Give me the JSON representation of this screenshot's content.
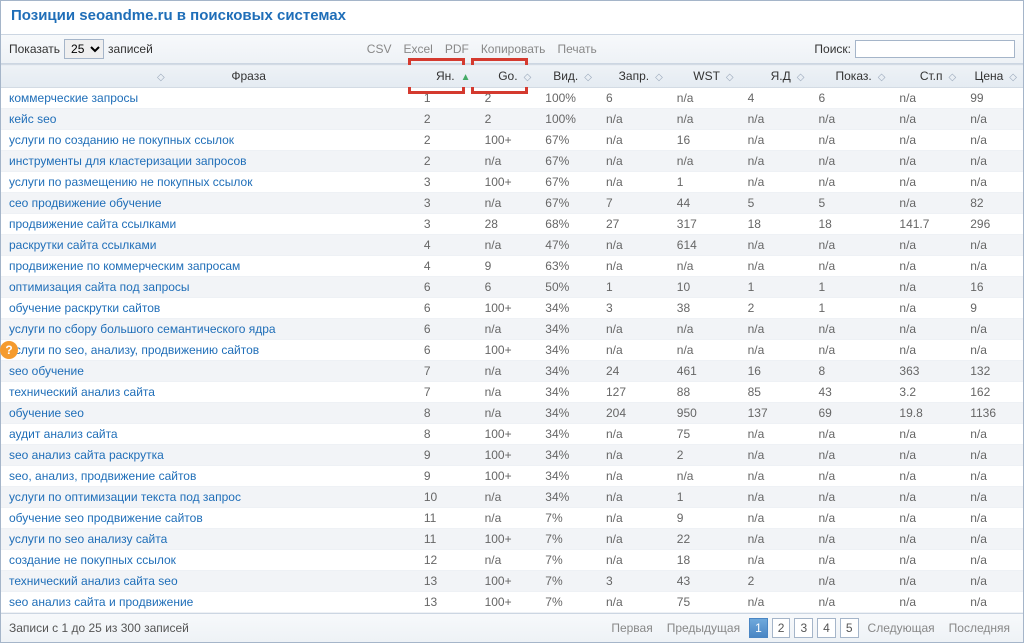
{
  "title": "Позиции seoandme.ru в поисковых системах",
  "toolbar": {
    "show_label": "Показать",
    "length_value": "25",
    "entries_label": "записей",
    "exports": [
      "CSV",
      "Excel",
      "PDF",
      "Копировать",
      "Печать"
    ],
    "search_label": "Поиск:"
  },
  "columns": [
    "Фраза",
    "Ян.",
    "Go.",
    "Вид.",
    "Запр.",
    "WST",
    "Я.Д",
    "Показ.",
    "Ст.п",
    "Цена"
  ],
  "rows": [
    {
      "phrase": "коммерческие запросы",
      "yan": "1",
      "go": "2",
      "vid": "100%",
      "zapr": "6",
      "wst": "n/a",
      "yad": "4",
      "pokaz": "6",
      "stp": "n/a",
      "cena": "99"
    },
    {
      "phrase": "кейс seo",
      "yan": "2",
      "go": "2",
      "vid": "100%",
      "zapr": "n/a",
      "wst": "n/a",
      "yad": "n/a",
      "pokaz": "n/a",
      "stp": "n/a",
      "cena": "n/a"
    },
    {
      "phrase": "услуги по созданию не покупных ссылок",
      "yan": "2",
      "go": "100+",
      "vid": "67%",
      "zapr": "n/a",
      "wst": "16",
      "yad": "n/a",
      "pokaz": "n/a",
      "stp": "n/a",
      "cena": "n/a"
    },
    {
      "phrase": "инструменты для кластеризации запросов",
      "yan": "2",
      "go": "n/a",
      "vid": "67%",
      "zapr": "n/a",
      "wst": "n/a",
      "yad": "n/a",
      "pokaz": "n/a",
      "stp": "n/a",
      "cena": "n/a"
    },
    {
      "phrase": "услуги по размещению не покупных ссылок",
      "yan": "3",
      "go": "100+",
      "vid": "67%",
      "zapr": "n/a",
      "wst": "1",
      "yad": "n/a",
      "pokaz": "n/a",
      "stp": "n/a",
      "cena": "n/a"
    },
    {
      "phrase": "сео продвижение обучение",
      "yan": "3",
      "go": "n/a",
      "vid": "67%",
      "zapr": "7",
      "wst": "44",
      "yad": "5",
      "pokaz": "5",
      "stp": "n/a",
      "cena": "82"
    },
    {
      "phrase": "продвижение сайта ссылками",
      "yan": "3",
      "go": "28",
      "vid": "68%",
      "zapr": "27",
      "wst": "317",
      "yad": "18",
      "pokaz": "18",
      "stp": "141.7",
      "cena": "296"
    },
    {
      "phrase": "раскрутки сайта ссылками",
      "yan": "4",
      "go": "n/a",
      "vid": "47%",
      "zapr": "n/a",
      "wst": "614",
      "yad": "n/a",
      "pokaz": "n/a",
      "stp": "n/a",
      "cena": "n/a"
    },
    {
      "phrase": "продвижение по коммерческим запросам",
      "yan": "4",
      "go": "9",
      "vid": "63%",
      "zapr": "n/a",
      "wst": "n/a",
      "yad": "n/a",
      "pokaz": "n/a",
      "stp": "n/a",
      "cena": "n/a"
    },
    {
      "phrase": "оптимизация сайта под запросы",
      "yan": "6",
      "go": "6",
      "vid": "50%",
      "zapr": "1",
      "wst": "10",
      "yad": "1",
      "pokaz": "1",
      "stp": "n/a",
      "cena": "16"
    },
    {
      "phrase": "обучение раскрутки сайтов",
      "yan": "6",
      "go": "100+",
      "vid": "34%",
      "zapr": "3",
      "wst": "38",
      "yad": "2",
      "pokaz": "1",
      "stp": "n/a",
      "cena": "9"
    },
    {
      "phrase": "услуги по сбору большого семантического ядра",
      "yan": "6",
      "go": "n/a",
      "vid": "34%",
      "zapr": "n/a",
      "wst": "n/a",
      "yad": "n/a",
      "pokaz": "n/a",
      "stp": "n/a",
      "cena": "n/a"
    },
    {
      "phrase": "услуги по seo, анализу, продвижению сайтов",
      "yan": "6",
      "go": "100+",
      "vid": "34%",
      "zapr": "n/a",
      "wst": "n/a",
      "yad": "n/a",
      "pokaz": "n/a",
      "stp": "n/a",
      "cena": "n/a"
    },
    {
      "phrase": "seo обучение",
      "yan": "7",
      "go": "n/a",
      "vid": "34%",
      "zapr": "24",
      "wst": "461",
      "yad": "16",
      "pokaz": "8",
      "stp": "363",
      "cena": "132"
    },
    {
      "phrase": "технический анализ сайта",
      "yan": "7",
      "go": "n/a",
      "vid": "34%",
      "zapr": "127",
      "wst": "88",
      "yad": "85",
      "pokaz": "43",
      "stp": "3.2",
      "cena": "162"
    },
    {
      "phrase": "обучение seo",
      "yan": "8",
      "go": "n/a",
      "vid": "34%",
      "zapr": "204",
      "wst": "950",
      "yad": "137",
      "pokaz": "69",
      "stp": "19.8",
      "cena": "1136"
    },
    {
      "phrase": "аудит анализ сайта",
      "yan": "8",
      "go": "100+",
      "vid": "34%",
      "zapr": "n/a",
      "wst": "75",
      "yad": "n/a",
      "pokaz": "n/a",
      "stp": "n/a",
      "cena": "n/a"
    },
    {
      "phrase": "seo анализ сайта раскрутка",
      "yan": "9",
      "go": "100+",
      "vid": "34%",
      "zapr": "n/a",
      "wst": "2",
      "yad": "n/a",
      "pokaz": "n/a",
      "stp": "n/a",
      "cena": "n/a"
    },
    {
      "phrase": "seo, анализ, продвижение сайтов",
      "yan": "9",
      "go": "100+",
      "vid": "34%",
      "zapr": "n/a",
      "wst": "n/a",
      "yad": "n/a",
      "pokaz": "n/a",
      "stp": "n/a",
      "cena": "n/a"
    },
    {
      "phrase": "услуги по оптимизации текста под запрос",
      "yan": "10",
      "go": "n/a",
      "vid": "34%",
      "zapr": "n/a",
      "wst": "1",
      "yad": "n/a",
      "pokaz": "n/a",
      "stp": "n/a",
      "cena": "n/a"
    },
    {
      "phrase": "обучение seo продвижение сайтов",
      "yan": "11",
      "go": "n/a",
      "vid": "7%",
      "zapr": "n/a",
      "wst": "9",
      "yad": "n/a",
      "pokaz": "n/a",
      "stp": "n/a",
      "cena": "n/a"
    },
    {
      "phrase": "услуги по seo анализу сайта",
      "yan": "11",
      "go": "100+",
      "vid": "7%",
      "zapr": "n/a",
      "wst": "22",
      "yad": "n/a",
      "pokaz": "n/a",
      "stp": "n/a",
      "cena": "n/a"
    },
    {
      "phrase": "создание не покупных ссылок",
      "yan": "12",
      "go": "n/a",
      "vid": "7%",
      "zapr": "n/a",
      "wst": "18",
      "yad": "n/a",
      "pokaz": "n/a",
      "stp": "n/a",
      "cena": "n/a"
    },
    {
      "phrase": "технический анализ сайта seo",
      "yan": "13",
      "go": "100+",
      "vid": "7%",
      "zapr": "3",
      "wst": "43",
      "yad": "2",
      "pokaz": "n/a",
      "stp": "n/a",
      "cena": "n/a"
    },
    {
      "phrase": "seo анализ сайта и продвижение",
      "yan": "13",
      "go": "100+",
      "vid": "7%",
      "zapr": "n/a",
      "wst": "75",
      "yad": "n/a",
      "pokaz": "n/a",
      "stp": "n/a",
      "cena": "n/a"
    }
  ],
  "footer": {
    "info": "Записи с 1 до 25 из 300 записей",
    "first": "Первая",
    "prev": "Предыдущая",
    "pages": [
      "1",
      "2",
      "3",
      "4",
      "5"
    ],
    "next": "Следующая",
    "last": "Последняя"
  },
  "help": "?"
}
